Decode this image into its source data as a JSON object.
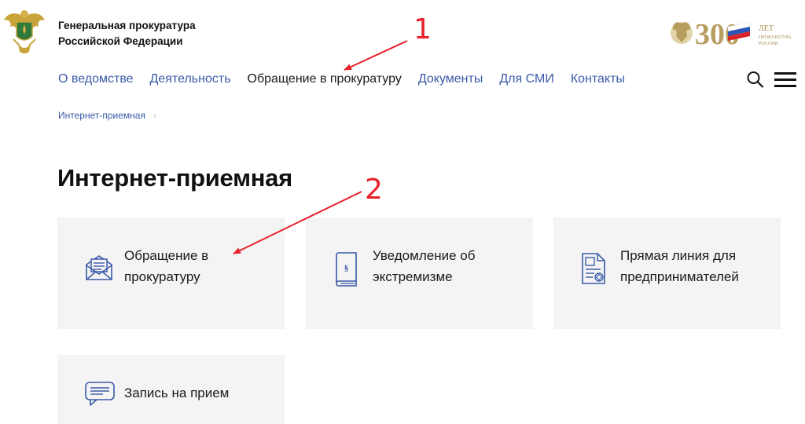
{
  "header": {
    "org_line1": "Генеральная прокуратура",
    "org_line2": "Российской Федерации",
    "anniversary_number": "300",
    "anniversary_word": "ЛЕТ",
    "anniversary_line1": "ПРОКУРАТУРА",
    "anniversary_line2": "РОССИИ"
  },
  "nav": {
    "items": [
      {
        "label": "О ведомстве",
        "active": false
      },
      {
        "label": "Деятельность",
        "active": false
      },
      {
        "label": "Обращение в прокуратуру",
        "active": true
      },
      {
        "label": "Документы",
        "active": false
      },
      {
        "label": "Для СМИ",
        "active": false
      },
      {
        "label": "Контакты",
        "active": false
      }
    ],
    "search_icon": "search-icon",
    "menu_icon": "hamburger-menu-icon"
  },
  "breadcrumb": {
    "items": [
      "Интернет-приемная"
    ]
  },
  "page": {
    "title": "Интернет-приемная"
  },
  "cards": [
    {
      "label": "Обращение в\nпрокуратуру",
      "icon": "envelope-letter-icon"
    },
    {
      "label": "Уведомление об\nэкстремизме",
      "icon": "law-book-icon"
    },
    {
      "label": "Прямая линия для\nпредпринимателей",
      "icon": "document-stamp-icon"
    },
    {
      "label": "Запись на прием",
      "icon": "chat-message-icon"
    }
  ],
  "annotations": {
    "marker_1": "1",
    "marker_2": "2",
    "color": "#e8202a"
  },
  "colors": {
    "link": "#3a5aa8",
    "card_bg": "#f4f4f4",
    "icon": "#3a5aa8"
  }
}
